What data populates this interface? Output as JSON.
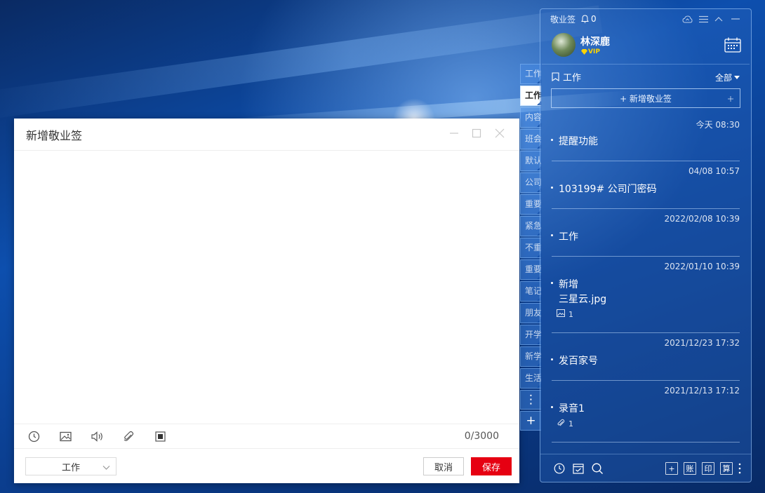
{
  "dialog": {
    "title": "新增敬业签",
    "counter": "0/3000",
    "category": "工作",
    "cancel_label": "取消",
    "save_label": "保存"
  },
  "side_tabs": [
    "工作",
    "工作",
    "内容",
    "班会",
    "默认",
    "公司",
    "重要",
    "紧急",
    "不重",
    "重要",
    "笔记",
    "朋友",
    "开学",
    "新学",
    "生活"
  ],
  "side_tabs_active_index": 1,
  "side_tab_buttons": {
    "more": "⋮",
    "add": "+"
  },
  "panel": {
    "brand": "敬业签",
    "bell_count": "0",
    "user": {
      "name": "林深鹿",
      "badge": "VIP"
    },
    "category": "工作",
    "filter": "全部",
    "add_label": "+ 新增敬业签",
    "notes": [
      {
        "time": "今天 08:30",
        "lines": [
          "提醒功能"
        ]
      },
      {
        "time": "04/08 10:57",
        "lines": [
          "103199# 公司门密码"
        ]
      },
      {
        "time": "2022/02/08 10:39",
        "lines": [
          "工作"
        ]
      },
      {
        "time": "2022/01/10 10:39",
        "lines": [
          "新增",
          "三星云.jpg"
        ],
        "attachment": {
          "icon": "image-icon",
          "count": "1"
        }
      },
      {
        "time": "2021/12/23 17:32",
        "lines": [
          "发百家号"
        ]
      },
      {
        "time": "2021/12/13 17:12",
        "lines": [
          "录音1"
        ],
        "attachment": {
          "icon": "paperclip-icon",
          "count": "1"
        }
      }
    ],
    "bottom_buttons": {
      "add": "+",
      "account": "账",
      "print": "印",
      "calc": "算"
    }
  },
  "colors": {
    "accent_red": "#e60012",
    "panel_border": "#aad2ff"
  }
}
